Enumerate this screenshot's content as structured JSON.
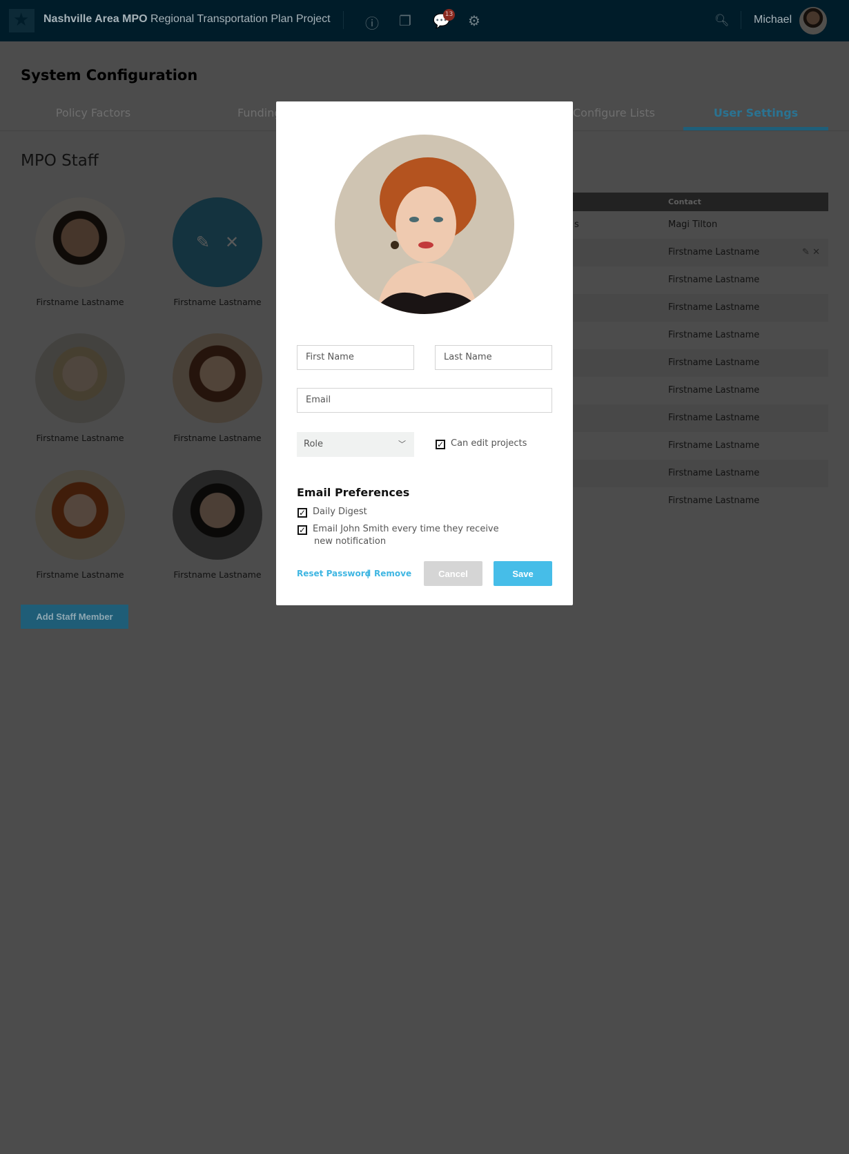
{
  "header": {
    "brand": "Nashville Area MPO",
    "project": "Regional Transportation Plan Project",
    "notification_count": "13",
    "user": "Michael",
    "icons": [
      "logo-icon",
      "info-icon",
      "documents-icon",
      "chat-icon",
      "gear-icon",
      "search-icon"
    ]
  },
  "page": {
    "title": "System Configuration",
    "tabs": [
      {
        "label": "Policy Factors"
      },
      {
        "label": "Funding"
      },
      {
        "label": "Configure Lists"
      },
      {
        "label": "User Settings",
        "active": true
      }
    ]
  },
  "staff": {
    "title": "MPO Staff",
    "members": [
      "Firstname Lastname",
      "Firstname Lastname",
      "Firstname Lastname",
      "Firstname Lastname",
      "Firstname Lastname",
      "Firstname Lastname"
    ],
    "add_label": "Add Staff Member"
  },
  "table": {
    "header": "Contact",
    "partial_text": "s",
    "rows": [
      "Magi Tilton",
      "Firstname Lastname",
      "Firstname Lastname",
      "Firstname Lastname",
      "Firstname Lastname",
      "Firstname Lastname",
      "Firstname Lastname",
      "Firstname Lastname",
      "Firstname Lastname",
      "Firstname Lastname",
      "Firstname Lastname"
    ]
  },
  "modal": {
    "first_name_placeholder": "First Name",
    "last_name_placeholder": "Last Name",
    "email_placeholder": "Email",
    "role": "Role",
    "can_edit": "Can edit projects",
    "prefs_title": "Email Preferences",
    "daily_digest": "Daily Digest",
    "notify_line1": "Email John Smith every time they receive",
    "notify_line2": "new notification",
    "reset": "Reset Password",
    "sep": "|",
    "remove": "Remove",
    "cancel": "Cancel",
    "save": "Save"
  },
  "colors": {
    "header": "#005d88",
    "accent": "#3fb6e2",
    "badge": "#c0392b"
  }
}
